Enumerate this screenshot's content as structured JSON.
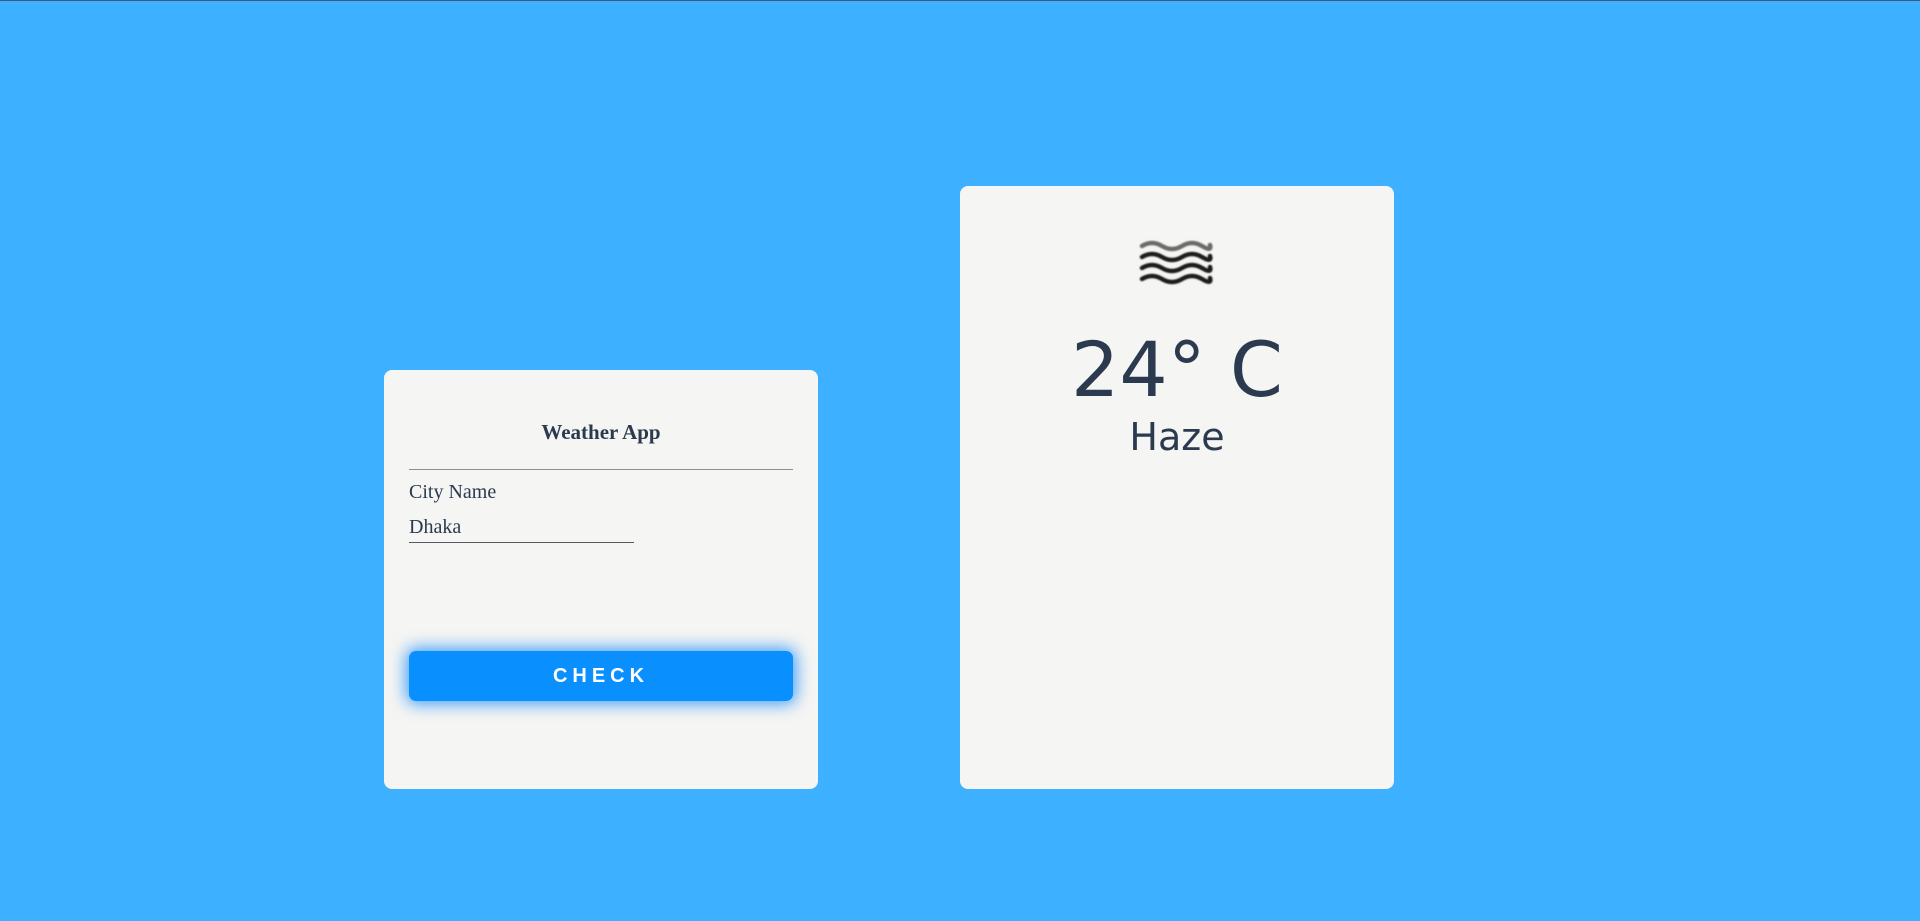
{
  "colors": {
    "background": "#3db0ff",
    "card": "#f5f5f3",
    "accent": "#0a8fff",
    "text": "#2b3a4f"
  },
  "form": {
    "title": "Weather App",
    "city_label": "City Name",
    "city_value": "Dhaka",
    "button_label": "CHECK"
  },
  "result": {
    "icon": "haze-icon",
    "temperature": "24° C",
    "condition": "Haze"
  }
}
